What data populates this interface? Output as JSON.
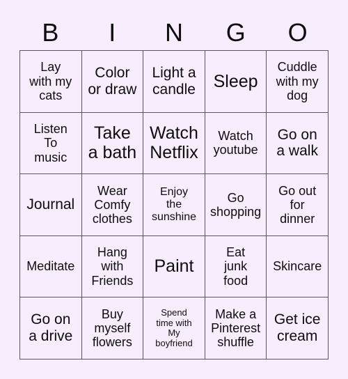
{
  "card": {
    "background_color": "#f8edfd",
    "border_color": "#5a5560",
    "text_color": "#0d0d0d"
  },
  "header": {
    "letters": [
      {
        "label": "B"
      },
      {
        "label": "I"
      },
      {
        "label": "N"
      },
      {
        "label": "G"
      },
      {
        "label": "O"
      }
    ]
  },
  "grid": {
    "rows": 5,
    "columns": 5,
    "cells": [
      {
        "text": "Lay\nwith my\ncats",
        "size": "fs-md"
      },
      {
        "text": "Color\nor draw",
        "size": "fs-lg"
      },
      {
        "text": "Light a\ncandle",
        "size": "fs-lg"
      },
      {
        "text": "Sleep",
        "size": "fs-xl"
      },
      {
        "text": "Cuddle\nwith my\ndog",
        "size": "fs-md"
      },
      {
        "text": "Listen\nTo\nmusic",
        "size": "fs-md"
      },
      {
        "text": "Take\na bath",
        "size": "fs-xl"
      },
      {
        "text": "Watch\nNetflix",
        "size": "fs-xl"
      },
      {
        "text": "Watch\nyoutube",
        "size": "fs-md"
      },
      {
        "text": "Go on\na walk",
        "size": "fs-lg"
      },
      {
        "text": "Journal",
        "size": "fs-lg"
      },
      {
        "text": "Wear\nComfy\nclothes",
        "size": "fs-md"
      },
      {
        "text": "Enjoy\nthe\nsunshine",
        "size": "fs-sm"
      },
      {
        "text": "Go\nshopping",
        "size": "fs-md"
      },
      {
        "text": "Go out\nfor\ndinner",
        "size": "fs-md"
      },
      {
        "text": "Meditate",
        "size": "fs-md"
      },
      {
        "text": "Hang\nwith\nFriends",
        "size": "fs-md"
      },
      {
        "text": "Paint",
        "size": "fs-xl"
      },
      {
        "text": "Eat\njunk\nfood",
        "size": "fs-md"
      },
      {
        "text": "Skincare",
        "size": "fs-md"
      },
      {
        "text": "Go on\na drive",
        "size": "fs-lg"
      },
      {
        "text": "Buy\nmyself\nflowers",
        "size": "fs-md"
      },
      {
        "text": "Spend\ntime with\nMy\nboyfriend",
        "size": "fs-xs"
      },
      {
        "text": "Make a\nPinterest\nshuffle",
        "size": "fs-md"
      },
      {
        "text": "Get ice\ncream",
        "size": "fs-lg"
      }
    ]
  }
}
